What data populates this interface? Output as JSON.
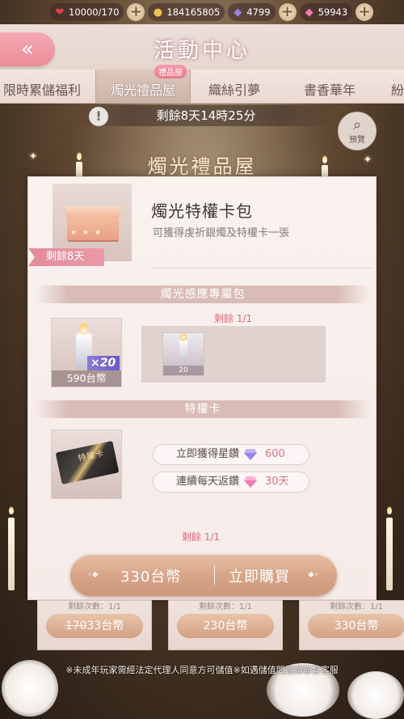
{
  "resources": [
    {
      "icon": "heart-icon",
      "glyph": "❤",
      "color": "#e2454f",
      "value": "10000/170"
    },
    {
      "icon": "cat-coin-icon",
      "glyph": "🐱",
      "color": "#f0c24d",
      "value": "184165805"
    },
    {
      "icon": "purple-diamond-icon",
      "glyph": "◆",
      "color": "#9b82e6",
      "value": "4799"
    },
    {
      "icon": "pink-diamond-icon",
      "glyph": "◆",
      "color": "#f07bb0",
      "value": "59943"
    }
  ],
  "header": {
    "title": "活動中心",
    "back_glyph": "«"
  },
  "tabs": [
    {
      "label": "限時累儲福利"
    },
    {
      "label": "燭光禮品屋",
      "badge": "禮品屋",
      "active": true
    },
    {
      "label": "織絲引夢"
    },
    {
      "label": "書香華年"
    },
    {
      "label": "紛"
    }
  ],
  "countdown": {
    "warn": "!",
    "text": "剩餘8天14時25分"
  },
  "preview": {
    "label": "預覽",
    "icon": "magnifier-icon"
  },
  "shop_title": "燭光禮品屋",
  "modal": {
    "package_name": "燭光特權卡包",
    "package_desc": "可獲得虔祈銀燭及特權卡一張",
    "remaining_tag": "剩餘8天",
    "section1": {
      "title": "燭光感應專屬包",
      "remaining": "剩餘 1/1",
      "item_qty": "×20",
      "item_price": "590台幣",
      "slot_count": "20"
    },
    "section2": {
      "title": "特權卡",
      "card_label": "特權卡",
      "perks": [
        {
          "label": "立即獲得星鑽",
          "value": "600",
          "gem_color": "#9b82e6"
        },
        {
          "label": "連續每天返鑽",
          "value": "30天",
          "gem_color": "#f07bb0"
        }
      ],
      "remaining": "剩餘 1/1"
    },
    "buy": {
      "price": "330台幣",
      "action": "立即購買"
    }
  },
  "bottom_cards": [
    {
      "count": "剩餘次數：1/1",
      "old_price": "170",
      "price": "33台幣"
    },
    {
      "count": "剩餘次數：1/1",
      "price": "230台幣"
    },
    {
      "count": "剩餘次數：1/1",
      "price": "330台幣"
    }
  ],
  "footer": "※未成年玩家需經法定代理人同意方可儲值※如遇儲值問題請聯繫客服"
}
